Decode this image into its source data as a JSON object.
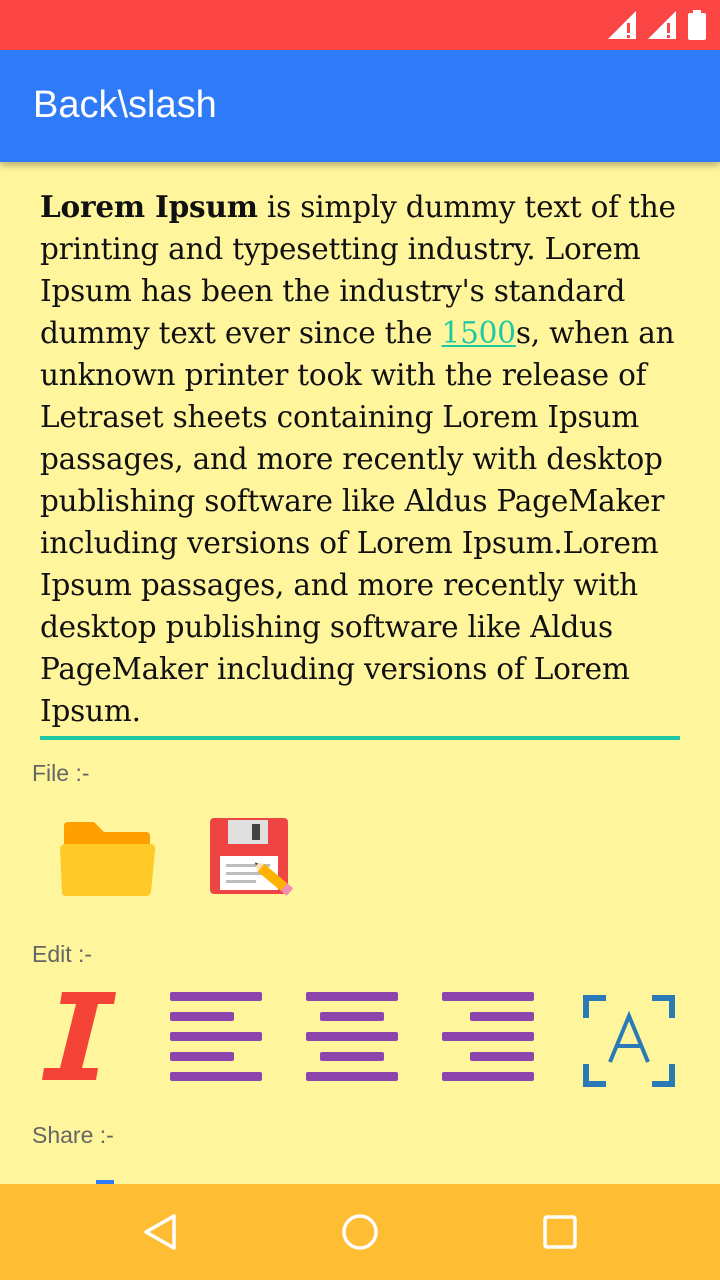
{
  "app": {
    "title": "Back\\slash"
  },
  "editor": {
    "bold_lead": "Lorem Ipsum",
    "text_part1": " is simply dummy text of the printing and typesetting industry. Lorem Ipsum has been the industry's standard dummy text ever since the ",
    "link_text": "1500",
    "text_part2": "s, when an unknown printer took with the release of Letraset sheets containing Lorem Ipsum passages, and more recently with desktop publishing software like Aldus PageMaker including versions of Lorem Ipsum.Lorem Ipsum passages, and more recently with desktop publishing software like Aldus PageMaker including versions of Lorem Ipsum."
  },
  "sections": {
    "file": "File :-",
    "edit": "Edit :-",
    "share": "Share :-"
  },
  "icons": {
    "open_file": "folder-icon",
    "save_file": "save-edit-icon",
    "italic": "italic-icon",
    "align_left": "align-left-icon",
    "align_center": "align-center-icon",
    "align_right": "align-right-icon",
    "text_select": "text-select-icon"
  },
  "colors": {
    "status_bar": "#fc4646",
    "app_bar": "#2f7af6",
    "background": "#fff59d",
    "accent": "#1dc9a3",
    "nav_bar": "#ffbd33"
  }
}
